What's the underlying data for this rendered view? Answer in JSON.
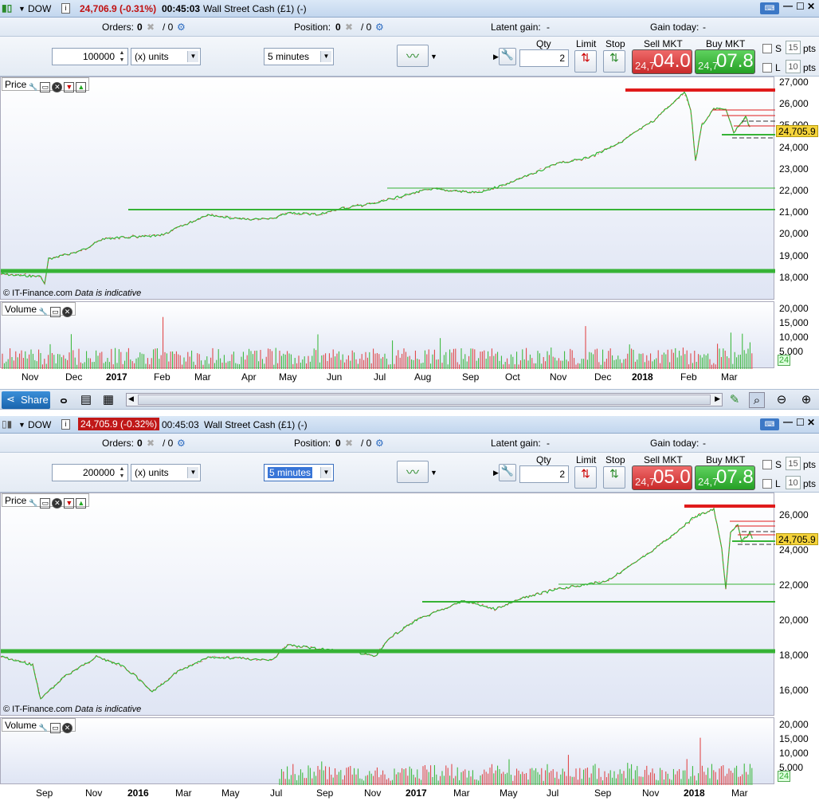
{
  "window1": {
    "symbol": "DOW",
    "price_change": "24,706.9 (-0.31%)",
    "time": "00:45:03",
    "instrument": "Wall Street Cash (£1) (-)",
    "orders_label": "Orders:",
    "orders_val1": "0",
    "orders_val2": "/ 0",
    "position_label": "Position:",
    "position_val1": "0",
    "position_val2": "/ 0",
    "latent_label": "Latent gain:",
    "latent_val": "-",
    "gain_label": "Gain today:",
    "gain_val": "-",
    "quantity": "100000",
    "units": "(x) units",
    "interval": "5 minutes",
    "qty_label": "Qty",
    "qty": "2",
    "limit_label": "Limit",
    "stop_label": "Stop",
    "sell_label": "Sell MKT",
    "sell_small": "24,7",
    "sell_big": "04.0",
    "buy_label": "Buy MKT",
    "buy_small": "24,7",
    "buy_big": "07.8",
    "s_label": "S",
    "s_val": "15",
    "l_label": "L",
    "l_val": "10",
    "pts": "pts",
    "price_pane": "Price",
    "volume_pane": "Volume",
    "credit": "© IT-Finance.com",
    "credit_note": "Data is indicative",
    "price_tag": "24,705.9",
    "vol_box": "24",
    "yticks": [
      "27,000",
      "26,000",
      "25,000",
      "24,000",
      "23,000",
      "22,000",
      "21,000",
      "20,000",
      "19,000",
      "18,000"
    ],
    "vticks": [
      "20,000",
      "15,000",
      "10,000",
      "5,000"
    ],
    "months": [
      {
        "t": "Nov",
        "b": false
      },
      {
        "t": "Dec",
        "b": false
      },
      {
        "t": "2017",
        "b": true
      },
      {
        "t": "Feb",
        "b": false
      },
      {
        "t": "Mar",
        "b": false
      },
      {
        "t": "Apr",
        "b": false
      },
      {
        "t": "May",
        "b": false
      },
      {
        "t": "Jun",
        "b": false
      },
      {
        "t": "Jul",
        "b": false
      },
      {
        "t": "Aug",
        "b": false
      },
      {
        "t": "Sep",
        "b": false
      },
      {
        "t": "Oct",
        "b": false
      },
      {
        "t": "Nov",
        "b": false
      },
      {
        "t": "Dec",
        "b": false
      },
      {
        "t": "2018",
        "b": true
      },
      {
        "t": "Feb",
        "b": false
      },
      {
        "t": "Mar",
        "b": false
      }
    ]
  },
  "toolbar": {
    "share_label": "Share"
  },
  "window2": {
    "symbol": "DOW",
    "price_change": "24,705.9 (-0.32%)",
    "time": "00:45:03",
    "instrument": "Wall Street Cash (£1) (-)",
    "orders_label": "Orders:",
    "orders_val1": "0",
    "orders_val2": "/ 0",
    "position_label": "Position:",
    "position_val1": "0",
    "position_val2": "/ 0",
    "latent_label": "Latent gain:",
    "latent_val": "-",
    "gain_label": "Gain today:",
    "gain_val": "-",
    "quantity": "200000",
    "units": "(x) units",
    "interval": "5 minutes",
    "qty_label": "Qty",
    "qty": "2",
    "limit_label": "Limit",
    "stop_label": "Stop",
    "sell_label": "Sell MKT",
    "sell_small": "24,7",
    "sell_big": "05.0",
    "buy_label": "Buy MKT",
    "buy_small": "24,7",
    "buy_big": "07.8",
    "s_label": "S",
    "s_val": "15",
    "l_label": "L",
    "l_val": "10",
    "pts": "pts",
    "price_pane": "Price",
    "volume_pane": "Volume",
    "credit": "© IT-Finance.com",
    "credit_note": "Data is indicative",
    "price_tag": "24,705.9",
    "vol_box": "24",
    "yticks": [
      "26,000",
      "24,000",
      "22,000",
      "20,000",
      "18,000",
      "16,000"
    ],
    "vticks": [
      "20,000",
      "15,000",
      "10,000",
      "5,000"
    ],
    "months": [
      {
        "t": "Sep",
        "b": false
      },
      {
        "t": "Nov",
        "b": false
      },
      {
        "t": "2016",
        "b": true
      },
      {
        "t": "Mar",
        "b": false
      },
      {
        "t": "May",
        "b": false
      },
      {
        "t": "Jul",
        "b": false
      },
      {
        "t": "Sep",
        "b": false
      },
      {
        "t": "Nov",
        "b": false
      },
      {
        "t": "2017",
        "b": true
      },
      {
        "t": "Mar",
        "b": false
      },
      {
        "t": "May",
        "b": false
      },
      {
        "t": "Jul",
        "b": false
      },
      {
        "t": "Sep",
        "b": false
      },
      {
        "t": "Nov",
        "b": false
      },
      {
        "t": "2018",
        "b": true
      },
      {
        "t": "Mar",
        "b": false
      }
    ]
  },
  "colors": {
    "accent": "#1a64ad",
    "up": "#2fb52f",
    "down": "#e03a3a",
    "level_red": "#e01b1b",
    "level_green": "#36b336",
    "price_tag": "#f5d33a"
  }
}
